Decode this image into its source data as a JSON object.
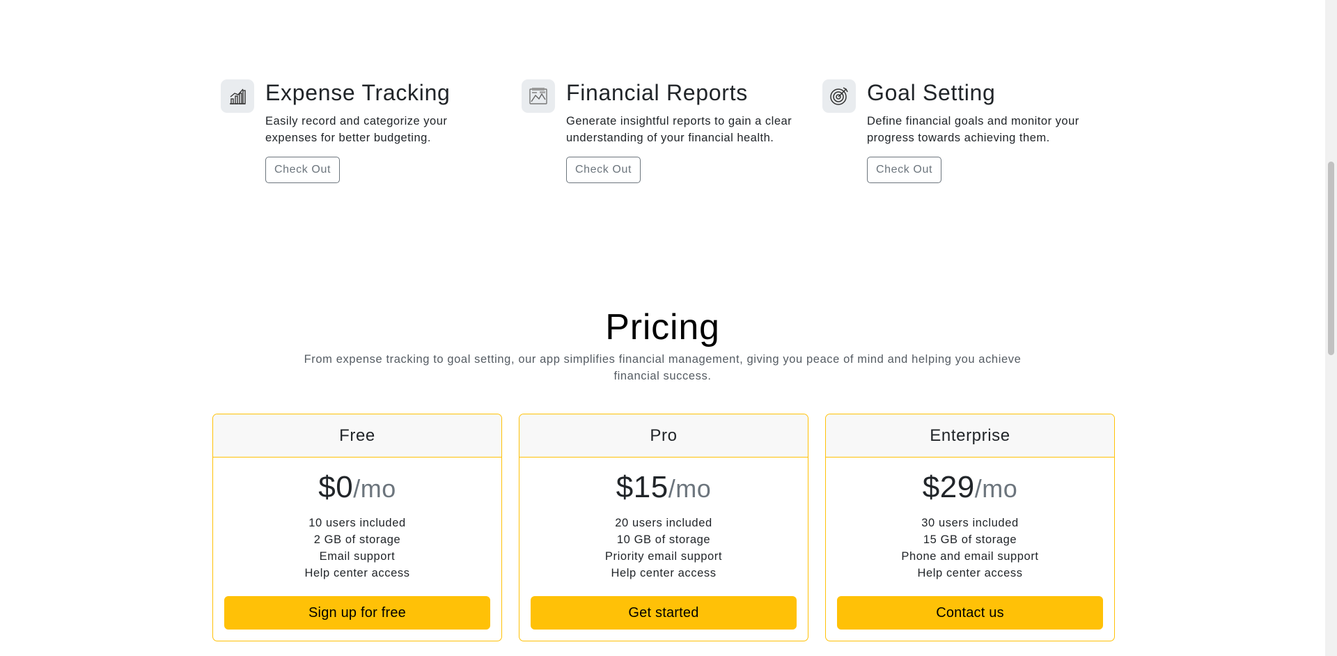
{
  "features": [
    {
      "icon": "bar-chart-icon",
      "title": "Expense Tracking",
      "description": "Easily record and categorize your expenses for better budgeting.",
      "button": "Check Out"
    },
    {
      "icon": "report-image-icon",
      "title": "Financial Reports",
      "description": "Generate insightful reports to gain a clear understanding of your financial health.",
      "button": "Check Out"
    },
    {
      "icon": "target-icon",
      "title": "Goal Setting",
      "description": "Define financial goals and monitor your progress towards achieving them.",
      "button": "Check Out"
    }
  ],
  "pricing": {
    "title": "Pricing",
    "subtitle": "From expense tracking to goal setting, our app simplifies financial management, giving you peace of mind and helping you achieve financial success.",
    "plans": [
      {
        "name": "Free",
        "price": "$0",
        "period": "/mo",
        "features": [
          "10 users included",
          "2 GB of storage",
          "Email support",
          "Help center access"
        ],
        "cta": "Sign up for free"
      },
      {
        "name": "Pro",
        "price": "$15",
        "period": "/mo",
        "features": [
          "20 users included",
          "10 GB of storage",
          "Priority email support",
          "Help center access"
        ],
        "cta": "Get started"
      },
      {
        "name": "Enterprise",
        "price": "$29",
        "period": "/mo",
        "features": [
          "30 users included",
          "15 GB of storage",
          "Phone and email support",
          "Help center access"
        ],
        "cta": "Contact us"
      }
    ]
  },
  "colors": {
    "accent": "#ffc107",
    "muted_text": "#6c757d",
    "icon_bg": "#e9ecef"
  }
}
